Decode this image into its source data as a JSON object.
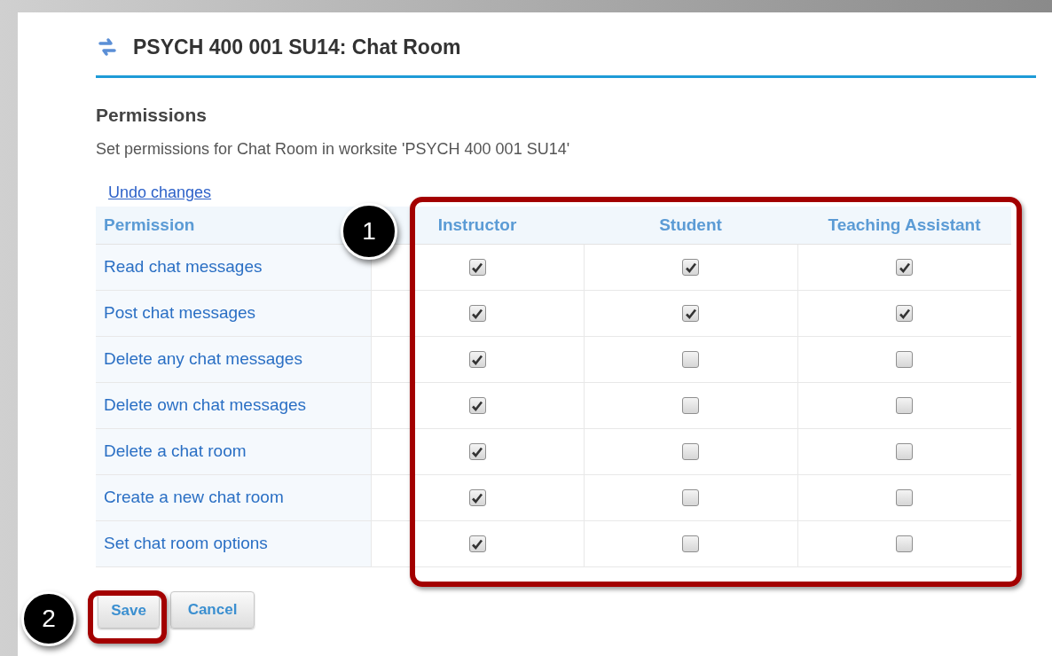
{
  "title": "PSYCH 400 001 SU14: Chat Room",
  "section": {
    "heading": "Permissions",
    "description": "Set permissions for Chat Room in worksite 'PSYCH 400 001 SU14'",
    "undo_link": "Undo changes"
  },
  "table": {
    "columns": [
      "Permission",
      "Instructor",
      "Student",
      "Teaching Assistant"
    ],
    "rows": [
      {
        "permission": "Read chat messages",
        "checked": [
          true,
          true,
          true
        ]
      },
      {
        "permission": "Post chat messages",
        "checked": [
          true,
          true,
          true
        ]
      },
      {
        "permission": "Delete any chat messages",
        "checked": [
          true,
          false,
          false
        ]
      },
      {
        "permission": "Delete own chat messages",
        "checked": [
          true,
          false,
          false
        ]
      },
      {
        "permission": "Delete a chat room",
        "checked": [
          true,
          false,
          false
        ]
      },
      {
        "permission": "Create a new chat room",
        "checked": [
          true,
          false,
          false
        ]
      },
      {
        "permission": "Set chat room options",
        "checked": [
          true,
          false,
          false
        ]
      }
    ]
  },
  "buttons": [
    {
      "label": "Save",
      "kind": "primary"
    },
    {
      "label": "Cancel",
      "kind": "secondary"
    }
  ],
  "callouts": [
    {
      "number": "1"
    },
    {
      "number": "2"
    }
  ]
}
